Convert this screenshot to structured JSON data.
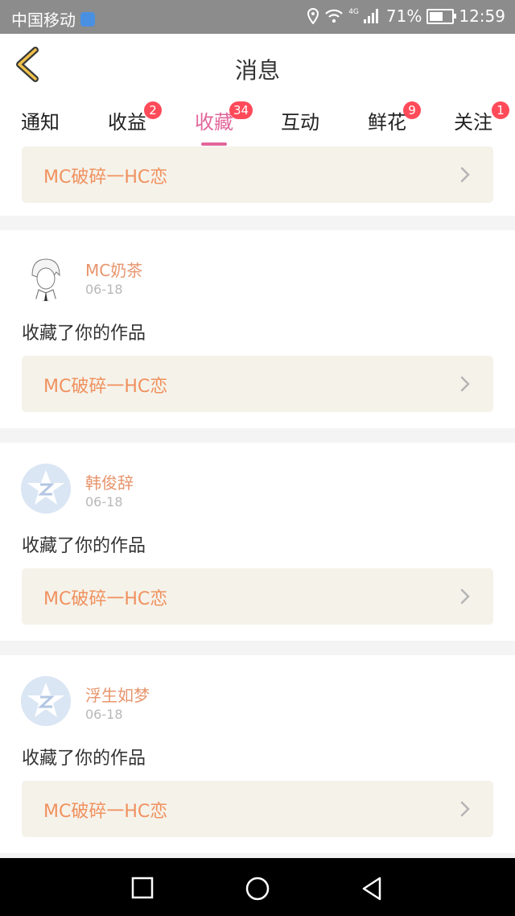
{
  "status_bar": {
    "carrier": "中国移动",
    "network": "4G",
    "battery_pct": "71%",
    "battery_level": 0.71,
    "time": "12:59"
  },
  "header": {
    "title": "消息"
  },
  "tabs": [
    {
      "label": "通知",
      "badge": ""
    },
    {
      "label": "收益",
      "badge": "2"
    },
    {
      "label": "收藏",
      "badge": "34"
    },
    {
      "label": "互动",
      "badge": ""
    },
    {
      "label": "鲜花",
      "badge": "9"
    },
    {
      "label": "关注",
      "badge": "1"
    }
  ],
  "active_tab": "收藏",
  "top_partial_item": {
    "work_title": "MC破碎一HC恋"
  },
  "items": [
    {
      "user": "MC奶茶",
      "date": "06-18",
      "action": "收藏了你的作品",
      "work_title": "MC破碎一HC恋",
      "avatar": "anime-avatar"
    },
    {
      "user": "韩俊辞",
      "date": "06-18",
      "action": "收藏了你的作品",
      "work_title": "MC破碎一HC恋",
      "avatar": "default-avatar"
    },
    {
      "user": "浮生如梦",
      "date": "06-18",
      "action": "收藏了你的作品",
      "work_title": "MC破碎一HC恋",
      "avatar": "default-avatar"
    }
  ],
  "colors": {
    "accent": "#e2679b",
    "badge": "#ff4a59",
    "username": "#e7946c",
    "work_title": "#f0915e"
  }
}
